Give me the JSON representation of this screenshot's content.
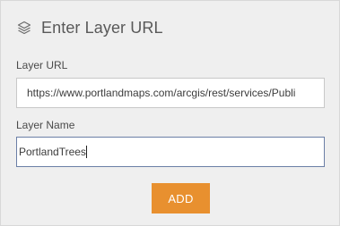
{
  "header": {
    "icon": "layers-icon",
    "title": "Enter Layer URL"
  },
  "form": {
    "url_label": "Layer URL",
    "url_value": "https://www.portlandmaps.com/arcgis/rest/services/Publi",
    "name_label": "Layer Name",
    "name_value": "PortlandTrees",
    "add_label": "ADD"
  },
  "colors": {
    "panel_background": "#efefef",
    "add_button": "#e8902f",
    "focused_border": "#6b7fa6"
  }
}
